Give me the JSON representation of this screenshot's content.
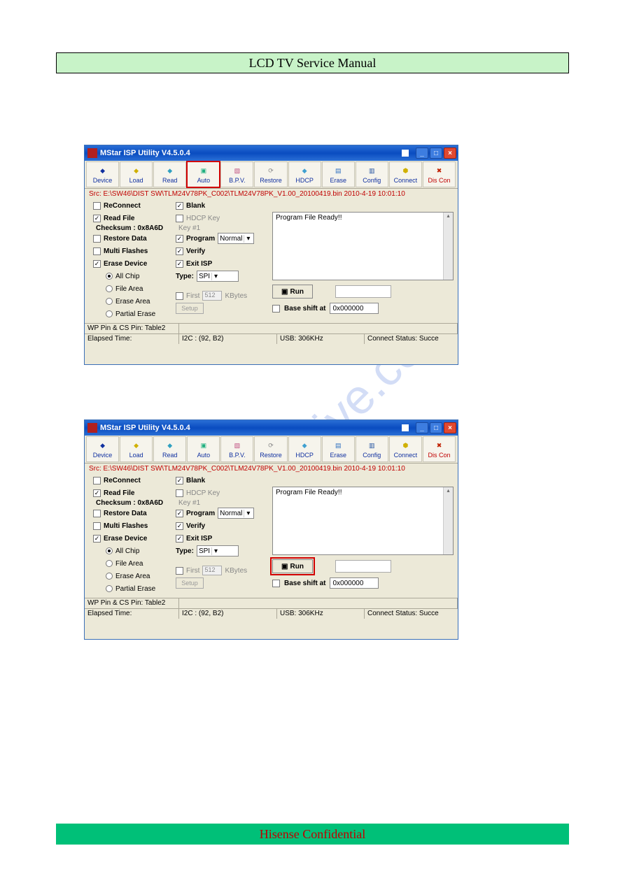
{
  "page": {
    "header": "LCD TV Service Manual",
    "footer": "Hisense Confidential",
    "watermark": "manualslive.com"
  },
  "window": {
    "title": "MStar ISP Utility V4.5.0.4",
    "src_line": "Src: E:\\SW46\\DIST SW\\TLM24V78PK_C002\\TLM24V78PK_V1.00_20100419.bin 2010-4-19 10:01:10"
  },
  "toolbar": {
    "device": "Device",
    "load": "Load",
    "read": "Read",
    "auto": "Auto",
    "bpv": "B.P.V.",
    "restore": "Restore",
    "hdcp": "HDCP",
    "erase": "Erase",
    "config": "Config",
    "connect": "Connect",
    "discon": "Dis Con"
  },
  "options": {
    "reconnect": "ReConnect",
    "readfile": "Read File",
    "checksum_label": "Checksum : 0x8A6D",
    "restoredata": "Restore Data",
    "multiflashes": "Multi Flashes",
    "erasedevice": "Erase Device",
    "allchip": "All Chip",
    "filearea": "File Area",
    "erasearea": "Erase Area",
    "partialerase": "Partial Erase",
    "blank": "Blank",
    "hdcpkey": "HDCP Key",
    "hdcpkey_sub": "Key #1",
    "program": "Program",
    "program_mode": "Normal",
    "verify": "Verify",
    "exitisp": "Exit ISP",
    "type_label": "Type:",
    "type_value": "SPI",
    "first": "First",
    "first_val": "512",
    "kbytes": "KBytes",
    "setup": "Setup",
    "run": "Run",
    "baseshift": "Base shift at",
    "baseshift_val": "0x000000",
    "log": "Program File Ready!!"
  },
  "status": {
    "wp": "WP Pin & CS Pin: Table2",
    "elapsed": "Elapsed Time:",
    "i2c": "I2C : (92, B2)",
    "usb": "USB: 306KHz",
    "connect": "Connect Status: Succe"
  }
}
